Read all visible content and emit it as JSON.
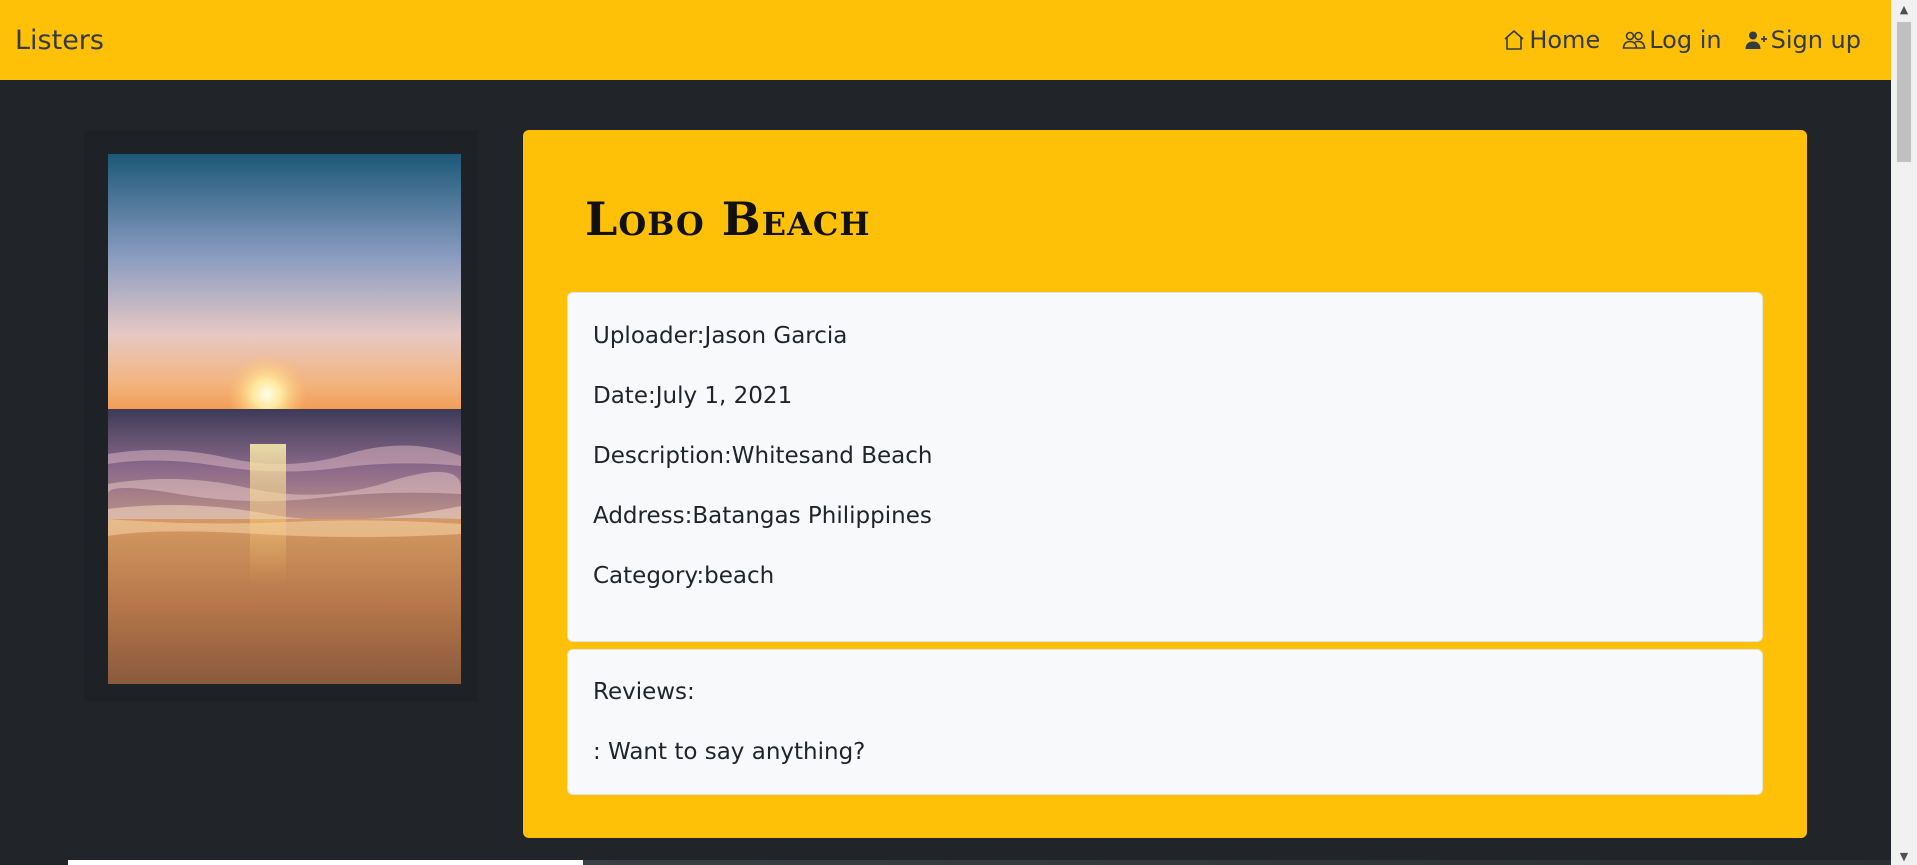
{
  "navbar": {
    "brand": "Listers",
    "links": [
      {
        "label": "Home",
        "icon": "home-icon"
      },
      {
        "label": "Log in",
        "icon": "people-icon"
      },
      {
        "label": "Sign up",
        "icon": "person-plus-icon"
      }
    ]
  },
  "listing": {
    "title": "Lobo Beach",
    "image": "beach-sunset-photo",
    "fields": [
      {
        "label": "Uploader:",
        "value": "Jason Garcia"
      },
      {
        "label": "Date:",
        "value": "July 1, 2021"
      },
      {
        "label": "Description:",
        "value": "Whitesand Beach"
      },
      {
        "label": "Address:",
        "value": "Batangas Philippines"
      },
      {
        "label": "Category:",
        "value": "beach"
      }
    ]
  },
  "reviews": {
    "label": "Reviews:",
    "prompt": ": Want to say anything?"
  },
  "colors": {
    "accent": "#ffc107",
    "background": "#212529",
    "card": "#f8f9fa"
  }
}
